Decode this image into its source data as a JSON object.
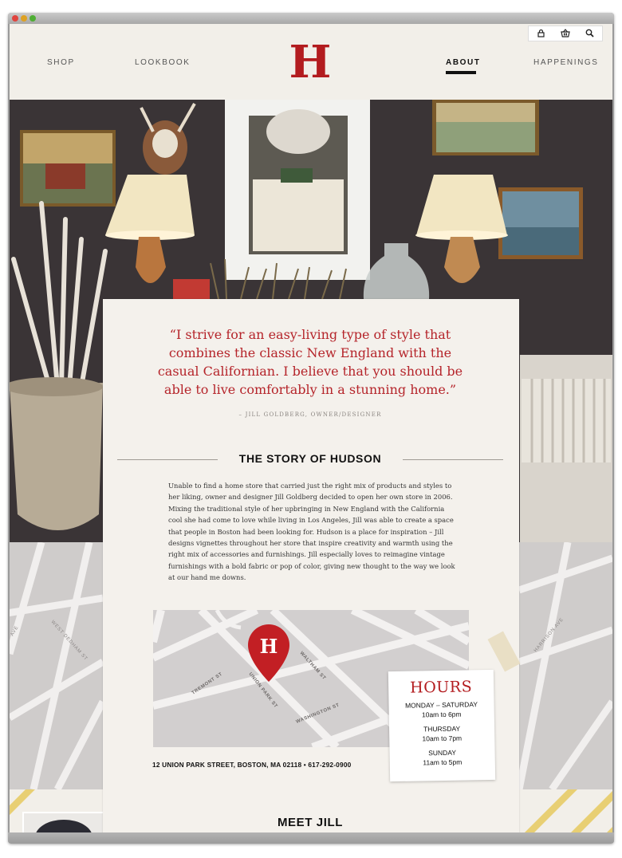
{
  "nav": {
    "shop": "SHOP",
    "lookbook": "LOOKBOOK",
    "about": "ABOUT",
    "happenings": "HAPPENINGS",
    "logo": "H"
  },
  "utility_icons": [
    "lock-icon",
    "basket-icon",
    "search-icon"
  ],
  "quote": {
    "text": "“I strive for an easy-living type of style that combines the classic New England with the casual Californian. I believe that you should be able to live comfortably in a stunning home.”",
    "attribution": "– JILL GOLDBERG, OWNER/DESIGNER"
  },
  "story": {
    "title": "THE STORY OF HUDSON",
    "body": "Unable to find a home store that carried just the right mix of products and styles to her liking, owner and designer Jill Goldberg decided to open her own store in 2006. Mixing the traditional style of her upbringing in New England  with the California cool she had come to love while living in Los Angeles, Jill was able to create a space that people in Boston had been looking for. Hudson is a place for inspiration – Jill designs vignettes throughout her store that inspire creativity and warmth using the right mix of accessories and furnishings. Jill especially loves to reimagine vintage furnishings with a bold fabric or pop of color, giving new thought to the way we look at our hand me downs."
  },
  "map": {
    "pin_letter": "H",
    "streets": [
      "TREMONT ST",
      "UNION PARK ST",
      "WALTHAM ST",
      "WASHINGTON ST"
    ],
    "bg_streets": [
      "WEST DEDHAM ST",
      "AVE",
      "HARRISON AVE"
    ]
  },
  "address": "12 UNION PARK STREET, BOSTON, MA 02118 • 617-292-0900",
  "hours": {
    "title": "HOURS",
    "rows": [
      {
        "day": "MONDAY – SATURDAY",
        "time": "10am to 6pm"
      },
      {
        "day": "THURSDAY",
        "time": "10am to 7pm"
      },
      {
        "day": "SUNDAY",
        "time": "11am to 5pm"
      }
    ]
  },
  "meet": {
    "title": "MEET JILL"
  },
  "colors": {
    "brand_red": "#b31c1f",
    "page_bg": "#f3f0ea",
    "map_grey": "#d2cfcf",
    "stripe_yellow": "#e8cf73"
  }
}
